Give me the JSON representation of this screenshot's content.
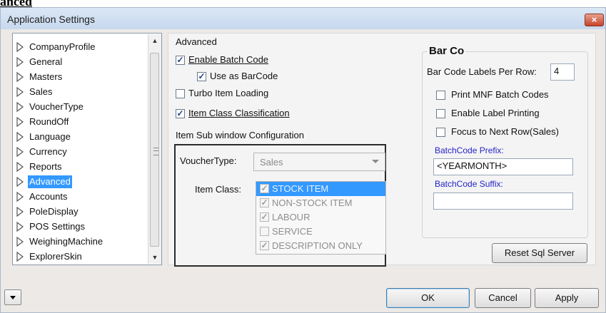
{
  "doc_heading": "anced",
  "window": {
    "title": "Application Settings",
    "close_glyph": "×"
  },
  "tree": {
    "items": [
      {
        "label": "CompanyProfile"
      },
      {
        "label": "General"
      },
      {
        "label": "Masters"
      },
      {
        "label": "Sales"
      },
      {
        "label": "VoucherType"
      },
      {
        "label": "RoundOff"
      },
      {
        "label": "Language"
      },
      {
        "label": "Currency"
      },
      {
        "label": "Reports"
      },
      {
        "label": "Advanced",
        "selected": true
      },
      {
        "label": "Accounts"
      },
      {
        "label": "PoleDisplay"
      },
      {
        "label": "POS Settings"
      },
      {
        "label": "WeighingMachine"
      },
      {
        "label": "ExplorerSkin"
      }
    ],
    "item_icon": "triangle-outline-icon"
  },
  "advanced": {
    "section_label": "Advanced",
    "enable_batch_code": {
      "label": "Enable Batch Code",
      "checked": true
    },
    "use_as_barcode": {
      "label": "Use as BarCode",
      "checked": true
    },
    "turbo_item_loading": {
      "label": "Turbo Item Loading",
      "checked": false
    },
    "item_class_classification": {
      "label": "Item Class Classification",
      "checked": true
    },
    "sub_window_label": "Item Sub window Configuration",
    "voucher_type_label": "VoucherType:",
    "voucher_type_value": "Sales",
    "item_class_label": "Item Class:",
    "item_classes": [
      {
        "label": "STOCK ITEM",
        "checked": true,
        "selected": true
      },
      {
        "label": "NON-STOCK ITEM",
        "checked": true
      },
      {
        "label": "LABOUR",
        "checked": true
      },
      {
        "label": "SERVICE",
        "checked": false
      },
      {
        "label": "DESCRIPTION ONLY",
        "checked": true
      }
    ]
  },
  "barcode": {
    "title": "Bar Co",
    "labels_per_row_label": "Bar Code Labels Per Row:",
    "labels_per_row_value": "4",
    "print_mnf": {
      "label": "Print MNF Batch Codes",
      "checked": false
    },
    "enable_label_printing": {
      "label": "Enable Label Printing",
      "checked": false
    },
    "focus_next_row": {
      "label": "Focus to Next Row(Sales)",
      "checked": false
    },
    "prefix_label": "BatchCode Prefix:",
    "prefix_value": "<YEARMONTH>",
    "suffix_label": "BatchCode Suffix:",
    "suffix_value": "",
    "reset_button": "Reset Sql Server"
  },
  "footer": {
    "ok": "OK",
    "cancel": "Cancel",
    "apply": "Apply"
  },
  "colors": {
    "selection": "#3399ff",
    "link_blue": "#2424c8",
    "close_red": "#c6432a"
  }
}
